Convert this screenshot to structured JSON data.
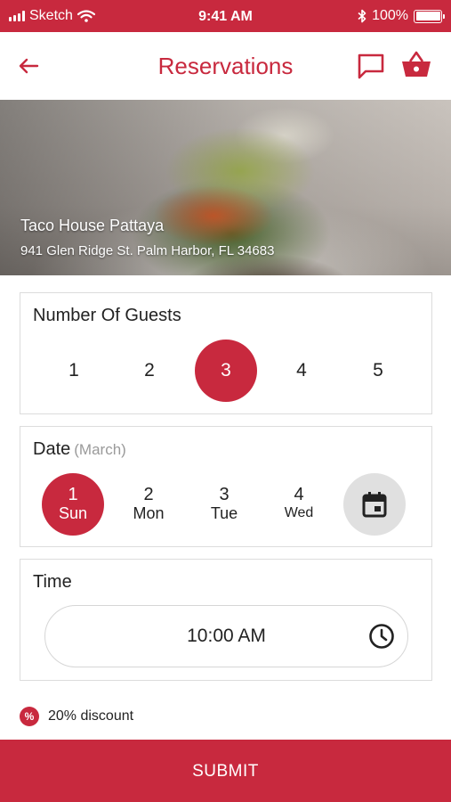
{
  "status_bar": {
    "carrier": "Sketch",
    "time": "9:41 AM",
    "battery": "100%"
  },
  "header": {
    "title": "Reservations",
    "icons": [
      "back-arrow-icon",
      "chat-icon",
      "basket-icon"
    ]
  },
  "restaurant": {
    "name": "Taco House Pattaya",
    "address": "941 Glen Ridge St. Palm Harbor, FL 34683"
  },
  "guests": {
    "title": "Number Of Guests",
    "options": [
      "1",
      "2",
      "3",
      "4",
      "5"
    ],
    "selected": "3"
  },
  "date": {
    "title": "Date",
    "month_hint": "(March)",
    "options": [
      {
        "num": "1",
        "day": "Sun"
      },
      {
        "num": "2",
        "day": "Mon"
      },
      {
        "num": "3",
        "day": "Tue"
      },
      {
        "num": "4",
        "day": "Wed"
      }
    ],
    "selected": "1",
    "calendar_icon": "calendar-icon"
  },
  "time": {
    "title": "Time",
    "value": "10:00 AM",
    "icon": "clock-icon"
  },
  "discount": {
    "badge": "%",
    "text": "20% discount"
  },
  "submit": {
    "label": "SUBMIT"
  },
  "colors": {
    "accent": "#c8293e",
    "calendar_button": "#e0e0e0"
  }
}
